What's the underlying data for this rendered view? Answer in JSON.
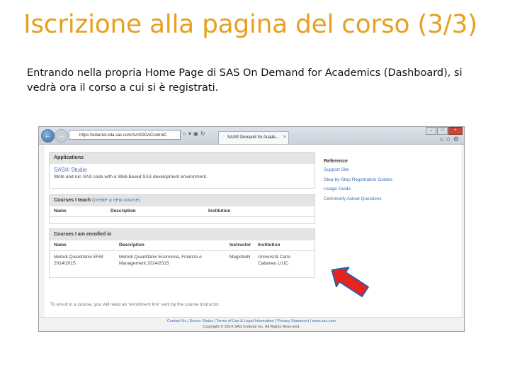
{
  "slide": {
    "title": "Iscrizione alla pagina del corso (3/3)",
    "body": "Entrando nella propria Home Page di SAS On Demand for Academics (Dashboard), si vedrà ora il corso a cui si è registrati."
  },
  "browser": {
    "address": "https://odamid.oda.sas.com/SASODAControlC",
    "tab_title": "SAS® Demand for Acade...",
    "nav_back_glyph": "←",
    "nav_fwd_glyph": "→"
  },
  "applications": {
    "header": "Applications",
    "app_name": "SAS® Studio",
    "app_desc": "Write and run SAS code with a Web-based SAS development environment."
  },
  "courses_teach": {
    "header": "Courses I teach",
    "create_link": "(create a new course)",
    "columns": [
      "Name",
      "Description",
      "Institution"
    ]
  },
  "courses_enrolled": {
    "header": "Courses I am enrolled in",
    "columns": [
      "Name",
      "Description",
      "Instructor",
      "Institution"
    ],
    "rows": [
      {
        "name": "Metodi Quantitativi EFM 2014/2015",
        "description": "Metodi Quantitativi Economia, Finanza e Management 2014/2015",
        "instructor": "Magistrelli",
        "institution": "Università Carlo Cattaneo LIUC"
      }
    ]
  },
  "enroll_note": "To enroll in a course, you will need an 'enrollment link' sent by the course instructor.",
  "reference": {
    "title": "Reference",
    "links": [
      "Support Site",
      "Step-by-Step Registration Guides",
      "Usage Guide",
      "Commonly Asked Questions"
    ]
  },
  "footer": {
    "links": "Contact Us | Server Status | Terms of Use & Legal Information | Privacy Statement | www.sas.com",
    "copyright": "Copyright © 2014 SAS Institute Inc. All Rights Reserved."
  },
  "colors": {
    "title_orange": "#e8a020",
    "link_blue": "#3b6fb6",
    "arrow_red": "#e8231f",
    "arrow_outline": "#2b5ea8"
  }
}
